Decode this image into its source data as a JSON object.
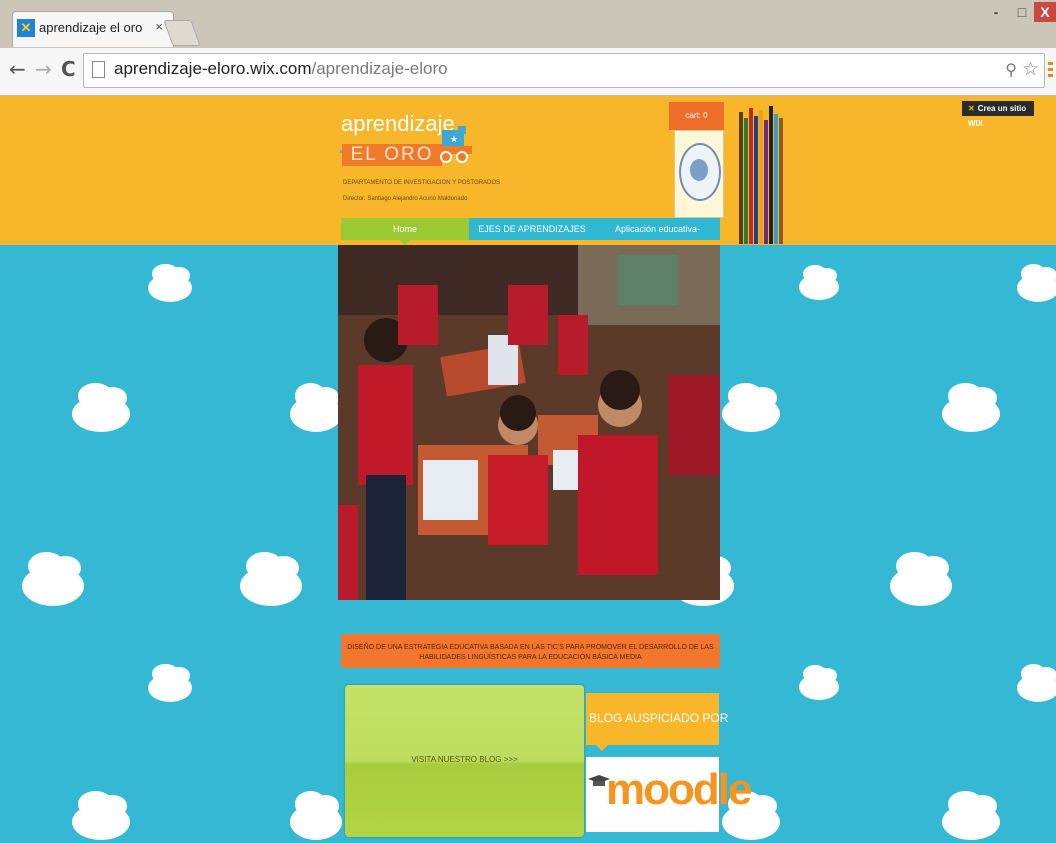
{
  "browser": {
    "tab_title": "aprendizaje el oro",
    "tab_close": "×",
    "url_host": "aprendizaje-eloro.wix.com",
    "url_path": "/aprendizaje-eloro",
    "win_min": "-",
    "win_max": "□",
    "win_close": "X"
  },
  "site": {
    "wix_badge": "Crea un sitio WIX",
    "logo_word": "aprendizaje",
    "logo_oro": "EL ORO",
    "department": "DEPARTAMENTO DE INVESTIGACION Y POSTGRADOS",
    "director": "Director: Santiago Alejandro Acurio Maldonado",
    "cart": "cart: 0",
    "nav": [
      "Home",
      "EJES DE APRENDIZAJES",
      "Aplicación educativa-educación media"
    ],
    "caption": "DISEÑO DE UNA ESTRATEGIA EDUCATIVA BASADA EN LAS TIC'S PARA PROMOVER EL DESARROLLO DE LAS HABILIDADES LINGÜÍSTICAS PARA LA EDUCACIÓN BÁSICA MEDIA",
    "blog_button": "VISITA NUESTRO BLOG >>>",
    "sponsor": "BLOG AUSPICIADO POR",
    "moodle": "moodle"
  },
  "colors": {
    "header_orange": "#f8b72a",
    "sky_blue": "#35b8d3",
    "nav_green": "#9cc932",
    "accent_orange": "#f2762e"
  }
}
